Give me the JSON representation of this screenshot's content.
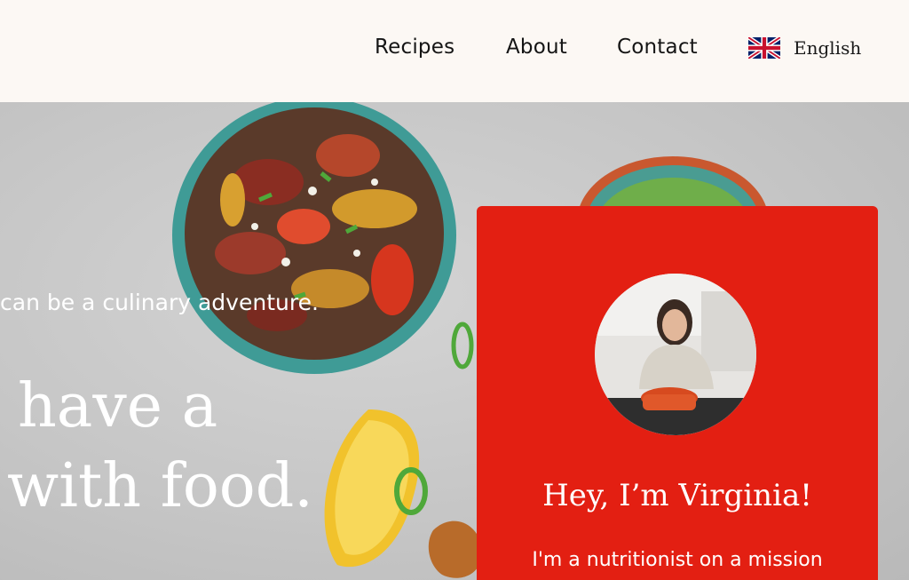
{
  "nav": {
    "items": [
      {
        "label": "Recipes"
      },
      {
        "label": "About"
      },
      {
        "label": "Contact"
      }
    ],
    "language": {
      "label": "English",
      "flag_icon": "uk-flag-icon"
    }
  },
  "hero": {
    "tagline": "can be a culinary adventure.",
    "headline_line1": "have a",
    "headline_line2": "with food."
  },
  "intro_card": {
    "title": "Hey, I’m Virginia!",
    "text": "I'm a nutritionist on a mission",
    "background_color": "#e31f12"
  },
  "colors": {
    "header_bg": "#fcf8f4",
    "accent": "#e31f12"
  }
}
